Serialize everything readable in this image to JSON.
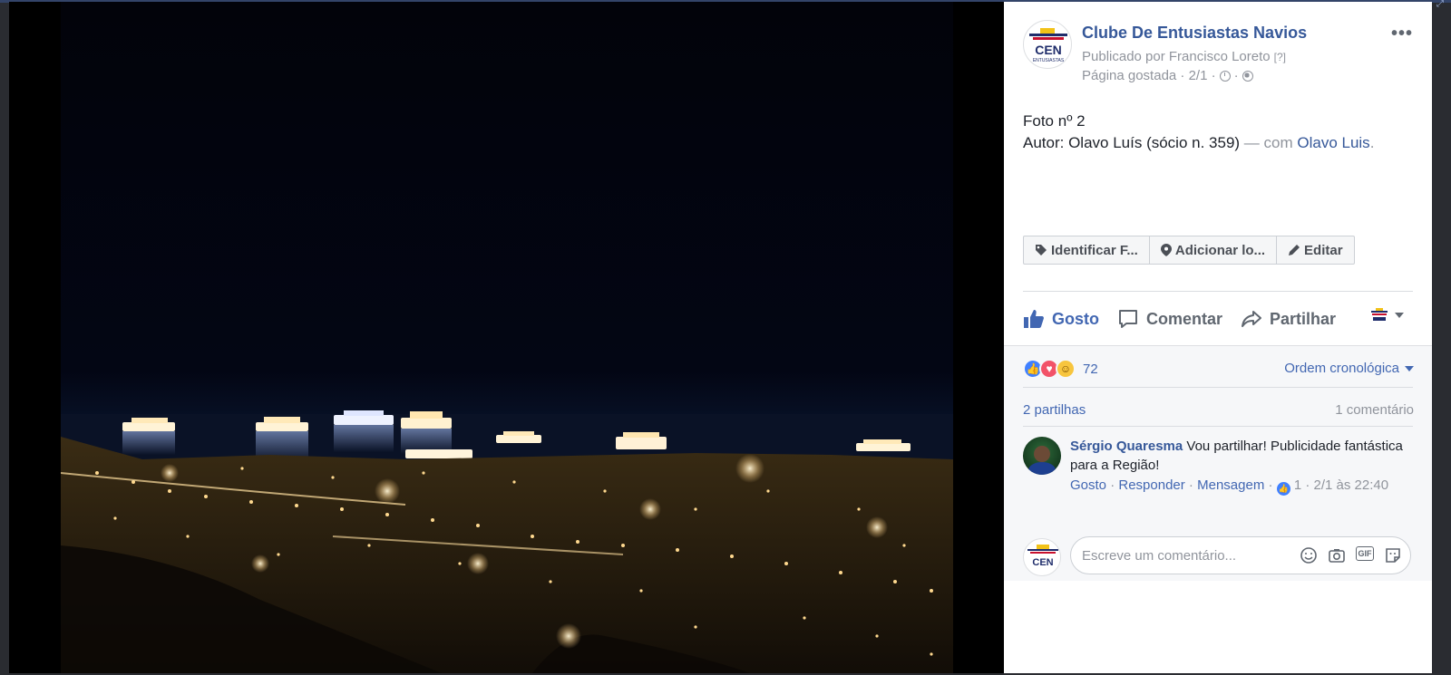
{
  "post": {
    "page_name": "Clube De Entusiastas Navios",
    "published_by": "Publicado por Francisco Loreto",
    "published_by_suffix": "[?]",
    "meta_text": "Página gostada · 2/1 ·",
    "meta_sep": "·",
    "more_label": "•••",
    "logo_text": "CEN",
    "logo_subtext": "ENTUSIASTAS",
    "caption_line1": "Foto nº 2",
    "caption_line2_main": "Autor: Olavo Luís (sócio n. 359)",
    "caption_line2_with": " — com ",
    "caption_tagged": "Olavo Luis",
    "caption_end": "."
  },
  "photo_actions": {
    "tag": "Identificar F...",
    "location": "Adicionar lo...",
    "edit": "Editar"
  },
  "action_bar": {
    "like": "Gosto",
    "comment": "Comentar",
    "share": "Partilhar"
  },
  "stats": {
    "reaction_count": "72",
    "order_label": "Ordem cronológica",
    "shares": "2 partilhas",
    "comments": "1 comentário"
  },
  "comment": {
    "author": "Sérgio Quaresma",
    "text": " Vou partilhar! Publicidade fantástica para a Região!",
    "like": "Gosto",
    "reply": "Responder",
    "message": "Mensagem",
    "sep": " · ",
    "likes": "1",
    "time": "2/1 às 22:40"
  },
  "composer": {
    "placeholder": "Escreve um comentário...",
    "gif_label": "GIF"
  },
  "colors": {
    "link": "#365899",
    "accent": "#4267b2",
    "muted": "#90949c"
  },
  "icons": [
    "tag-icon",
    "location-pin-icon",
    "pencil-icon",
    "thumbs-up-icon",
    "speech-bubble-icon",
    "share-arrow-icon",
    "clock-icon",
    "globe-icon",
    "smiley-icon",
    "camera-icon",
    "gif-icon",
    "sticker-icon"
  ]
}
